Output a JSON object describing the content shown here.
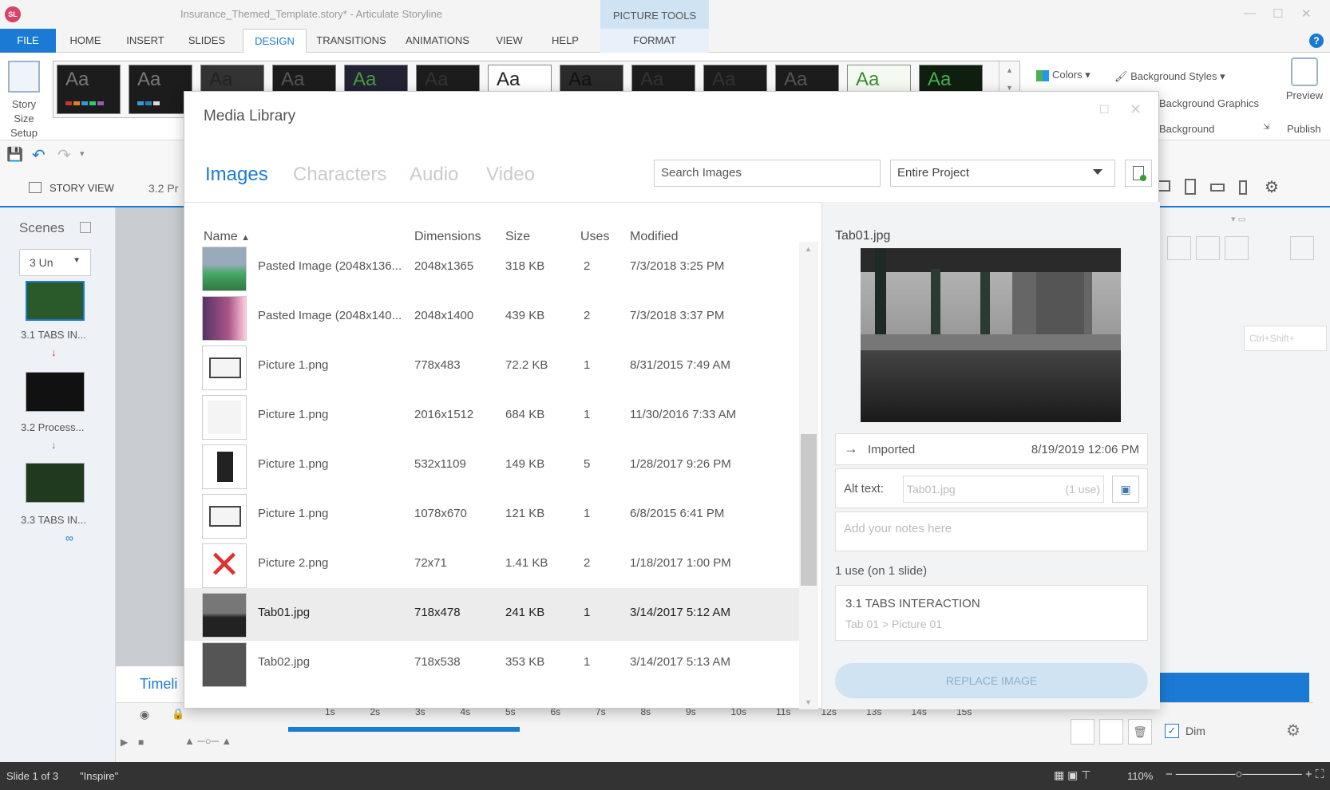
{
  "app": {
    "logo": "SL",
    "window_title": "Insurance_Themed_Template.story* - Articulate Storyline",
    "picture_tools": "PICTURE TOOLS"
  },
  "ribbon_tabs": [
    "FILE",
    "HOME",
    "INSERT",
    "SLIDES",
    "DESIGN",
    "TRANSITIONS",
    "ANIMATIONS",
    "VIEW",
    "HELP",
    "FORMAT"
  ],
  "ribbon": {
    "story_size": [
      "Story",
      "Size",
      "Setup"
    ],
    "colors": "Colors",
    "background_styles": "Background Styles",
    "background_graphics": "Background Graphics",
    "background": "Background",
    "preview": "Preview",
    "publish": "Publish",
    "theme_glyph": "Aa"
  },
  "viewbar": {
    "story_view": "STORY VIEW",
    "slide_tab": "3.2 Pr"
  },
  "scenes": {
    "title": "Scenes",
    "selector": "3 Un",
    "slides": [
      "3.1 TABS IN...",
      "3.2 Process...",
      "3.3 TABS IN..."
    ]
  },
  "right_panel": {
    "shortcut_hint": "Ctrl+Shift+"
  },
  "timeline": {
    "label": "Timeli",
    "ticks": [
      "1s",
      "2s",
      "3s",
      "4s",
      "5s",
      "6s",
      "7s",
      "8s",
      "9s",
      "10s",
      "11s",
      "12s",
      "13s",
      "14s",
      "15s"
    ],
    "dim": "Dim"
  },
  "status": {
    "slide": "Slide 1 of 3",
    "theme": "\"Inspire\"",
    "zoom": "110%"
  },
  "dialog": {
    "title": "Media Library",
    "tabs": [
      "Images",
      "Characters",
      "Audio",
      "Video"
    ],
    "search_placeholder": "Search Images",
    "scope": "Entire Project",
    "columns": [
      "Name",
      "Dimensions",
      "Size",
      "Uses",
      "Modified"
    ],
    "rows": [
      {
        "name": "Pasted Image (2048x136...",
        "dim": "2048x1365",
        "size": "318 KB",
        "uses": "2",
        "modified": "7/3/2018 3:25 PM"
      },
      {
        "name": "Pasted Image (2048x140...",
        "dim": "2048x1400",
        "size": "439 KB",
        "uses": "2",
        "modified": "7/3/2018 3:37 PM"
      },
      {
        "name": "Picture 1.png",
        "dim": "778x483",
        "size": "72.2 KB",
        "uses": "1",
        "modified": "8/31/2015 7:49 AM"
      },
      {
        "name": "Picture 1.png",
        "dim": "2016x1512",
        "size": "684 KB",
        "uses": "1",
        "modified": "11/30/2016 7:33 AM"
      },
      {
        "name": "Picture 1.png",
        "dim": "532x1109",
        "size": "149 KB",
        "uses": "5",
        "modified": "1/28/2017 9:26 PM"
      },
      {
        "name": "Picture 1.png",
        "dim": "1078x670",
        "size": "121 KB",
        "uses": "1",
        "modified": "6/8/2015 6:41 PM"
      },
      {
        "name": "Picture 2.png",
        "dim": "72x71",
        "size": "1.41 KB",
        "uses": "2",
        "modified": "1/18/2017 1:00 PM"
      },
      {
        "name": "Tab01.jpg",
        "dim": "718x478",
        "size": "241 KB",
        "uses": "1",
        "modified": "3/14/2017 5:12 AM"
      },
      {
        "name": "Tab02.jpg",
        "dim": "718x538",
        "size": "353 KB",
        "uses": "1",
        "modified": "3/14/2017 5:13 AM"
      }
    ],
    "details": {
      "name": "Tab01.jpg",
      "imported_label": "Imported",
      "imported_date": "8/19/2019 12:06 PM",
      "alt_label": "Alt text:",
      "alt_value": "Tab01.jpg",
      "alt_uses": "(1 use)",
      "notes_placeholder": "Add your notes here",
      "uses_summary": "1 use (on 1 slide)",
      "usage_slide": "3.1 TABS INTERACTION",
      "usage_path": "Tab 01 > Picture 01",
      "replace": "REPLACE IMAGE"
    }
  },
  "colors": {
    "accent": "#1b7ad3",
    "file_tab": "#1b7ad3",
    "picture_tools": "#cfe3f3"
  }
}
